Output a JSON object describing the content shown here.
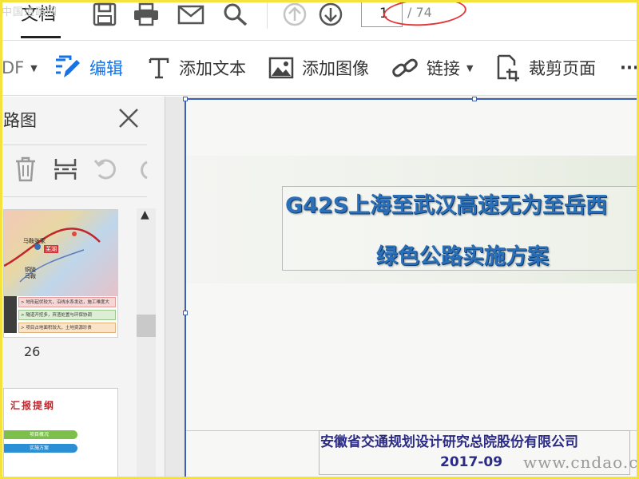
{
  "watermark_top": "中国道路网",
  "watermark_bottom": "www.cndao.com",
  "header": {
    "tab": "文档",
    "page_current": "1",
    "page_total": "/ 74"
  },
  "toolbar": {
    "pdf_label": "DF",
    "edit": "编辑",
    "add_text": "添加文本",
    "add_image": "添加图像",
    "link": "链接",
    "crop": "裁剪页面",
    "more": "···"
  },
  "panel": {
    "title": "路图",
    "thumb_page_number": "26",
    "thumb1": {
      "label_top": "马鞍张家",
      "label_mid": "芜湖",
      "label_left": "铜陵",
      "label_left2": "马鞍",
      "rows": [
        "> 地形起伏较大，沿线水系发达，施工难度大",
        "> 隧道开挖多，弃渣处置与环保协调",
        "> 项目占地面积较大，土地资源珍贵"
      ]
    },
    "thumb2": {
      "title": "汇报提纲",
      "items": [
        "项目概况",
        "实施方案"
      ]
    }
  },
  "slide": {
    "title_line1": "G42S上海至武汉高速无为至岳西",
    "title_line2": "绿色公路实施方案",
    "company": "安徽省交通规划设计研究总院股份有限公司",
    "date": "2017-09"
  },
  "colors": {
    "accent_blue": "#1473e6",
    "title_blue": "#2a6fb8",
    "company_navy": "#2c2b86",
    "annotation_red": "#e13838",
    "frame_yellow": "#f5e33b"
  }
}
